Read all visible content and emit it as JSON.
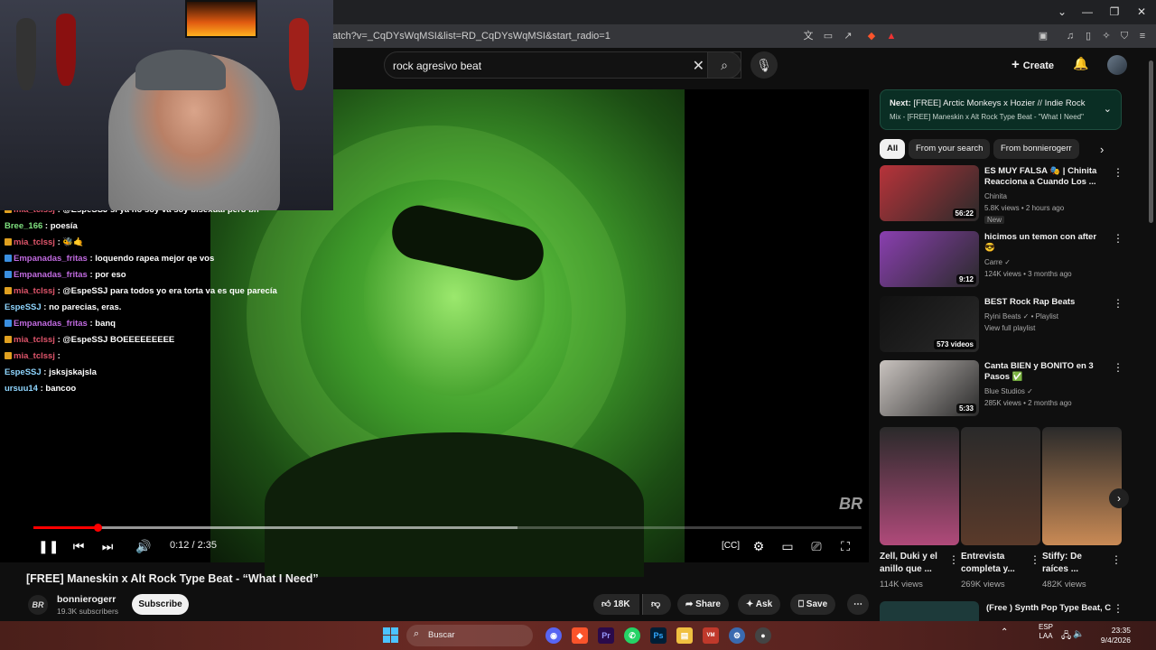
{
  "browser": {
    "url": "atch?v=_CqDYsWqMSI&list=RD_CqDYsWqMSI&start_radio=1",
    "window_controls": [
      "⌄",
      "—",
      "❐",
      "✕"
    ]
  },
  "youtube": {
    "search": {
      "query": "rock agresivo beat"
    },
    "create_label": "Create",
    "player": {
      "time": "0:12 / 2:35",
      "progress_fraction": 0.077,
      "buffered_fraction": 0.585,
      "watermark": "BR"
    },
    "video_title": "[FREE] Maneskin x Alt Rock Type Beat - “What I Need”",
    "channel": {
      "logo": "BR",
      "name": "bonnierogerr",
      "subscribers": "19.3K subscribers",
      "subscribe_label": "Subscribe"
    },
    "actions": {
      "likes": "18K",
      "share": "Share",
      "ask": "Ask",
      "save": "Save"
    },
    "next": {
      "line1_prefix": "Next:",
      "line1_title": "[FREE] Arctic Monkeys x Hozier // Indie Rock ...",
      "line2": "Mix - [FREE] Maneskin x Alt Rock Type Beat - \"What I Need\""
    },
    "chips": [
      "All",
      "From your search",
      "From bonnierogerr"
    ],
    "recommended": [
      {
        "title": "ES MUY FALSA 🎭 | Chinita Reacciona a Cuando Los ...",
        "channel": "Chinita",
        "meta": "5.8K views • 2 hours ago",
        "badge": "New",
        "duration": "56:22",
        "color": "#b8333a"
      },
      {
        "title": "hicimos un temon con after 😎",
        "channel": "Carre ✓",
        "meta": "124K views • 3 months ago",
        "duration": "9:12",
        "color": "#8a3fb0"
      },
      {
        "title": "BEST Rock Rap Beats",
        "channel": "Ryini Beats ✓ • Playlist",
        "meta": "View full playlist",
        "duration": "573 videos",
        "color": "#111111"
      },
      {
        "title": "Canta BIEN y BONITO en 3 Pasos ✅",
        "channel": "Blue Studios ✓",
        "meta": "285K views • 2 months ago",
        "duration": "5:33",
        "color": "#c9c3bf"
      }
    ],
    "shorts": [
      {
        "title": "Zell, Duki y el anillo que ...",
        "views": "114K views",
        "color": "#b04a7a"
      },
      {
        "title": "Entrevista completa y...",
        "views": "269K views",
        "color": "#5a3a2a"
      },
      {
        "title": "Stiffy: De raíces ...",
        "views": "482K views",
        "color": "#c98a55"
      }
    ],
    "bottom_rec": "(Free ) Synth Pop Type Beat, Cody Simpson Type Beat, The"
  },
  "chat": [
    {
      "user": "mia_tclssj",
      "color": "#e0556b",
      "text": ": @EspeSSJ si ya no soy va soy bisexual pero bn",
      "badge": "#e0a020"
    },
    {
      "user": "Bree_166",
      "color": "#7fe07f",
      "text": ": poesía",
      "badge": ""
    },
    {
      "user": "mia_tclssj",
      "color": "#e0556b",
      "text": ": 🐝🤙",
      "badge": "#e0a020"
    },
    {
      "user": "Empanadas_fritas",
      "color": "#c06adf",
      "text": ": loquendo rapea mejor qe vos",
      "badge": "#3a8fe0"
    },
    {
      "user": "Empanadas_fritas",
      "color": "#c06adf",
      "text": ": por eso",
      "badge": "#3a8fe0"
    },
    {
      "user": "mia_tclssj",
      "color": "#e0556b",
      "text": ": @EspeSSJ para todos yo era torta      va es que parecía",
      "badge": "#e0a020"
    },
    {
      "user": "EspeSSJ",
      "color": "#8fd6ff",
      "text": ": no parecias, eras.",
      "badge": ""
    },
    {
      "user": "Empanadas_fritas",
      "color": "#c06adf",
      "text": ": banq",
      "badge": "#3a8fe0"
    },
    {
      "user": "mia_tclssj",
      "color": "#e0556b",
      "text": ": @EspeSSJ BOEEEEEEEEE",
      "badge": "#e0a020"
    },
    {
      "user": "mia_tclssj",
      "color": "#e0556b",
      "text": ":",
      "badge": "#e0a020"
    },
    {
      "user": "EspeSSJ",
      "color": "#8fd6ff",
      "text": ": jsksjskajsla",
      "badge": ""
    },
    {
      "user": "ursuu14",
      "color": "#8fd6ff",
      "text": ": bancoo",
      "badge": ""
    }
  ],
  "taskbar": {
    "search_label": "Buscar",
    "lang": "ESP\nLAA",
    "time": "23:35",
    "date": "9/4/2026"
  }
}
